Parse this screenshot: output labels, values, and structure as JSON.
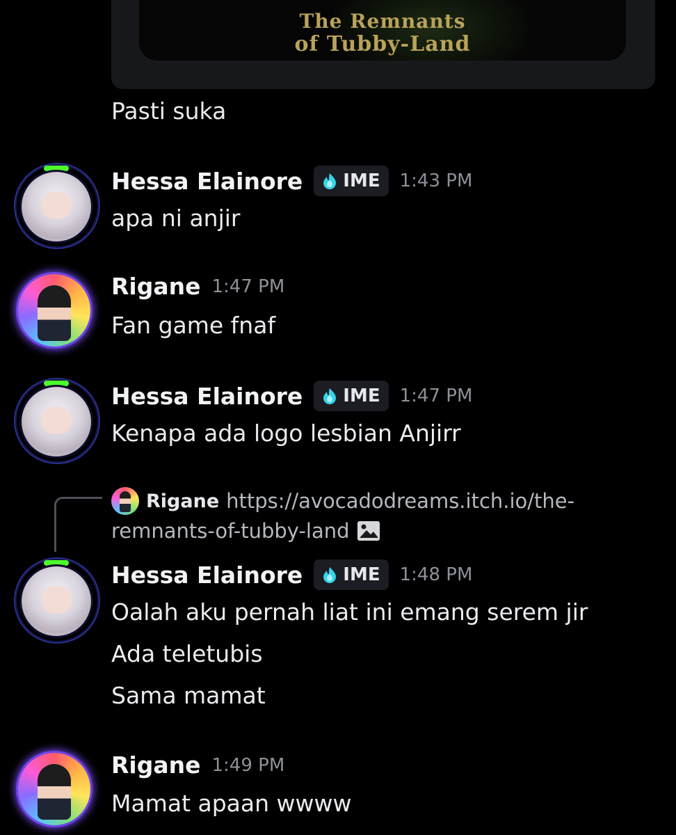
{
  "embed": {
    "title_line1": "The Remnants",
    "title_line2": "of Tubby-Land"
  },
  "messages": [
    {
      "type": "continuation",
      "text": "Pasti suka"
    },
    {
      "author": "Hessa Elainore",
      "tag": "IME",
      "time": "1:43 PM",
      "lines": [
        "apa ni anjir"
      ]
    },
    {
      "author": "Rigane",
      "time": "1:47 PM",
      "lines": [
        "Fan game fnaf"
      ]
    },
    {
      "author": "Hessa Elainore",
      "tag": "IME",
      "time": "1:47 PM",
      "lines": [
        "Kenapa ada logo lesbian Anjirr"
      ]
    },
    {
      "reply_to": {
        "author": "Rigane",
        "text_line1": "https://avocadodreams.itch.io/the-",
        "text_line2": "remnants-of-tubby-land"
      },
      "author": "Hessa Elainore",
      "tag": "IME",
      "time": "1:48 PM",
      "lines": [
        "Oalah aku pernah liat ini emang serem jir",
        "Ada teletubis",
        "Sama mamat"
      ]
    },
    {
      "author": "Rigane",
      "time": "1:49 PM",
      "lines": [
        "Mamat apaan wwww"
      ]
    }
  ],
  "icons": {
    "tag_icon": "flame-gem-icon",
    "reply_attachment": "image-icon"
  },
  "colors": {
    "background": "#000000",
    "tag_background": "#1b1d22",
    "tag_icon": "#37d3ea",
    "timestamp": "#8e9199"
  }
}
